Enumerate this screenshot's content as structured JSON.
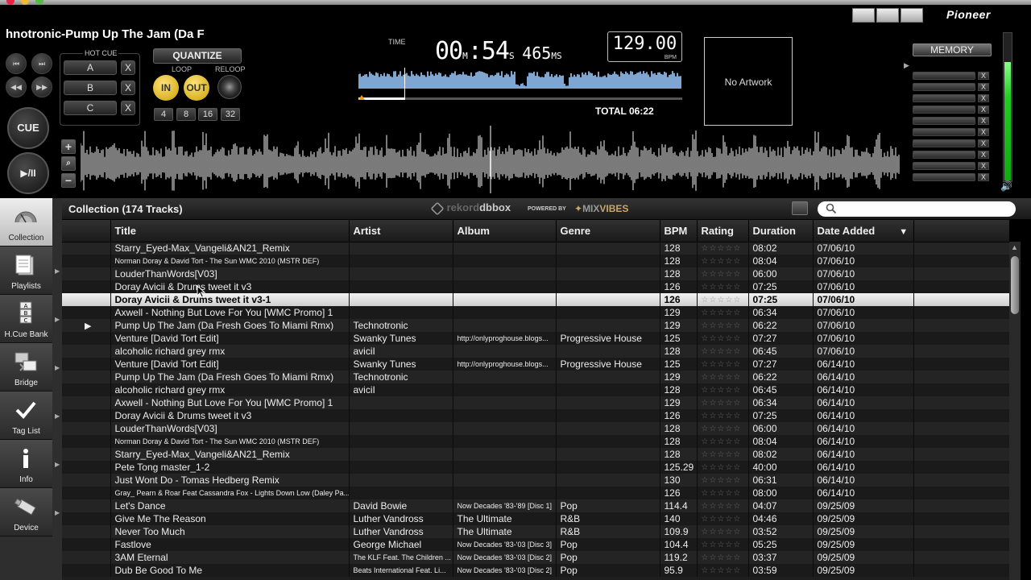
{
  "player": {
    "track_title": "hnotronic-Pump Up The Jam (Da F",
    "hot_cue_label": "HOT CUE",
    "hot_cues": [
      "A",
      "B",
      "C"
    ],
    "hot_cue_delete": "X",
    "quantize_label": "QUANTIZE",
    "loop_label": "LOOP",
    "reloop_label": "RELOOP",
    "loop_in": "IN",
    "loop_out": "OUT",
    "beat_loops": [
      "4",
      "8",
      "16",
      "32"
    ],
    "cue_label": "CUE",
    "play_label": "▶/II",
    "time_label": "TIME",
    "time_minutes": "00",
    "time_minutes_unit": "M",
    "time_seconds": ":54",
    "time_seconds_unit": "S",
    "time_ms": "465",
    "time_ms_unit": "MS",
    "bpm_value": "129.00",
    "bpm_unit": "BPM",
    "total_label": "TOTAL 06:22",
    "artwork_text": "No Artwork",
    "memory_label": "MEMORY",
    "memory_delete": "X",
    "brand": "Pioneer",
    "position_fraction": 0.143,
    "level_fraction": 0.8
  },
  "sidebar": {
    "items": [
      {
        "label": "Collection",
        "icon": "collection-icon",
        "active": true
      },
      {
        "label": "Playlists",
        "icon": "playlists-icon"
      },
      {
        "label": "H.Cue Bank",
        "icon": "hcue-bank-icon"
      },
      {
        "label": "Bridge",
        "icon": "bridge-icon"
      },
      {
        "label": "Tag List",
        "icon": "checkmark-icon"
      },
      {
        "label": "Info",
        "icon": "info-icon"
      },
      {
        "label": "Device",
        "icon": "usb-device-icon"
      }
    ]
  },
  "browser": {
    "collection_label": "Collection (174 Tracks)",
    "logo_rekord": "rekord",
    "logo_box": "box",
    "powered_by": "POWERED BY",
    "mixvibes_mix": "MIX",
    "mixvibes_vibes": "VIBES",
    "search_placeholder": "",
    "sort_indicator": "▼"
  },
  "table": {
    "columns": [
      "",
      "Title",
      "Artist",
      "Album",
      "Genre",
      "BPM",
      "Rating",
      "Duration",
      "Date Added"
    ],
    "rating_stars": "☆☆☆☆☆",
    "rows": [
      {
        "ind": "",
        "title": "Starry_Eyed-Max_Vangeli&AN21_Remix",
        "artist": "",
        "album": "",
        "genre": "",
        "bpm": "128",
        "duration": "08:02",
        "date": "07/06/10"
      },
      {
        "ind": "",
        "title": "Norman Doray & David Tort  - The Sun WMC 2010 (MSTR DEF)",
        "small_title": true,
        "artist": "",
        "album": "",
        "genre": "",
        "bpm": "128",
        "duration": "08:04",
        "date": "07/06/10"
      },
      {
        "ind": "",
        "title": "LouderThanWords[V03]",
        "artist": "",
        "album": "",
        "genre": "",
        "bpm": "128",
        "duration": "06:00",
        "date": "07/06/10"
      },
      {
        "ind": "",
        "title": "Doray Avicii & Drums tweet it v3",
        "artist": "",
        "album": "",
        "genre": "",
        "bpm": "126",
        "duration": "07:25",
        "date": "07/06/10"
      },
      {
        "ind": "",
        "title": "Doray Avicii & Drums tweet it v3-1",
        "artist": "",
        "album": "",
        "genre": "",
        "bpm": "126",
        "duration": "07:25",
        "date": "07/06/10",
        "selected": true
      },
      {
        "ind": "",
        "title": "Axwell - Nothing But Love For You [WMC Promo] 1",
        "artist": "",
        "album": "",
        "genre": "",
        "bpm": "129",
        "duration": "06:34",
        "date": "07/06/10"
      },
      {
        "ind": "▶",
        "title": "Pump Up The Jam (Da Fresh Goes To Miami Rmx)",
        "artist": "Technotronic",
        "album": "",
        "genre": "",
        "bpm": "129",
        "duration": "06:22",
        "date": "07/06/10"
      },
      {
        "ind": "",
        "title": "Venture [David Tort Edit]",
        "artist": "Swanky Tunes",
        "album": "http://onlyproghouse.blogs...",
        "small_album": true,
        "genre": "Progressive House",
        "bpm": "125",
        "duration": "07:27",
        "date": "07/06/10"
      },
      {
        "ind": "",
        "title": "alcoholic richard grey rmx",
        "artist": "aviciI",
        "album": "",
        "genre": "",
        "bpm": "128",
        "duration": "06:45",
        "date": "07/06/10"
      },
      {
        "ind": "",
        "title": "Venture [David Tort Edit]",
        "artist": "Swanky Tunes",
        "album": "http://onlyproghouse.blogs...",
        "small_album": true,
        "genre": "Progressive House",
        "bpm": "125",
        "duration": "07:27",
        "date": "06/14/10"
      },
      {
        "ind": "",
        "title": "Pump Up The Jam (Da Fresh Goes To Miami Rmx)",
        "artist": "Technotronic",
        "album": "",
        "genre": "",
        "bpm": "129",
        "duration": "06:22",
        "date": "06/14/10"
      },
      {
        "ind": "",
        "title": "alcoholic richard grey rmx",
        "artist": "aviciI",
        "album": "",
        "genre": "",
        "bpm": "128",
        "duration": "06:45",
        "date": "06/14/10"
      },
      {
        "ind": "",
        "title": "Axwell - Nothing But Love For You [WMC Promo] 1",
        "artist": "",
        "album": "",
        "genre": "",
        "bpm": "129",
        "duration": "06:34",
        "date": "06/14/10"
      },
      {
        "ind": "",
        "title": "Doray Avicii & Drums tweet it v3",
        "artist": "",
        "album": "",
        "genre": "",
        "bpm": "126",
        "duration": "07:25",
        "date": "06/14/10"
      },
      {
        "ind": "",
        "title": "LouderThanWords[V03]",
        "artist": "",
        "album": "",
        "genre": "",
        "bpm": "128",
        "duration": "06:00",
        "date": "06/14/10"
      },
      {
        "ind": "",
        "title": "Norman Doray & David Tort  - The Sun WMC 2010 (MSTR DEF)",
        "small_title": true,
        "artist": "",
        "album": "",
        "genre": "",
        "bpm": "128",
        "duration": "08:04",
        "date": "06/14/10"
      },
      {
        "ind": "",
        "title": "Starry_Eyed-Max_Vangeli&AN21_Remix",
        "artist": "",
        "album": "",
        "genre": "",
        "bpm": "128",
        "duration": "08:02",
        "date": "06/14/10"
      },
      {
        "ind": "",
        "title": "Pete Tong master_1-2",
        "artist": "",
        "album": "",
        "genre": "",
        "bpm": "125.29",
        "duration": "40:00",
        "date": "06/14/10"
      },
      {
        "ind": "",
        "title": "Just Wont Do - Tomas Hedberg Remix",
        "artist": "",
        "album": "",
        "genre": "",
        "bpm": "130",
        "duration": "06:31",
        "date": "06/14/10"
      },
      {
        "ind": "",
        "title": "Gray_ Pearn & Roar Feat Cassandra Fox - Lights Down Low (Daley Pa...",
        "small_title": true,
        "artist": "",
        "album": "",
        "genre": "",
        "bpm": "126",
        "duration": "08:00",
        "date": "06/14/10"
      },
      {
        "ind": "",
        "title": "Let's Dance",
        "artist": "David Bowie",
        "album": "Now Decades '83-'89 [Disc 1]",
        "small_album": true,
        "genre": "Pop",
        "bpm": "114.4",
        "duration": "04:07",
        "date": "09/25/09"
      },
      {
        "ind": "",
        "title": "Give Me The Reason",
        "artist": "Luther Vandross",
        "album": "The Ultimate",
        "genre": "R&B",
        "bpm": "140",
        "duration": "04:46",
        "date": "09/25/09"
      },
      {
        "ind": "",
        "title": "Never Too Much",
        "artist": "Luther Vandross",
        "album": "The Ultimate",
        "genre": "R&B",
        "bpm": "109.9",
        "duration": "03:52",
        "date": "09/25/09"
      },
      {
        "ind": "",
        "title": "Fastlove",
        "artist": "George Michael",
        "album": "Now Decades '83-'03 [Disc 3]",
        "small_album": true,
        "genre": "Pop",
        "bpm": "104.4",
        "duration": "05:25",
        "date": "09/25/09"
      },
      {
        "ind": "",
        "title": "3AM Eternal",
        "artist": "The KLF Feat. The Children ...",
        "small_artist": true,
        "album": "Now Decades '83-'03 [Disc 2]",
        "small_album": true,
        "genre": "Pop",
        "bpm": "119.2",
        "duration": "03:37",
        "date": "09/25/09"
      },
      {
        "ind": "",
        "title": "Dub Be Good To Me",
        "artist": "Beats International Feat. Li...",
        "small_artist": true,
        "album": "Now Decades '83-'03 [Disc 2]",
        "small_album": true,
        "genre": "Pop",
        "bpm": "95.9",
        "duration": "03:59",
        "date": "09/25/09"
      }
    ]
  },
  "colors": {
    "loop_button": "#f0c419",
    "waveform": "#7fa6d0",
    "level": "#22cc22",
    "selected_row": "#e6e6e6"
  }
}
